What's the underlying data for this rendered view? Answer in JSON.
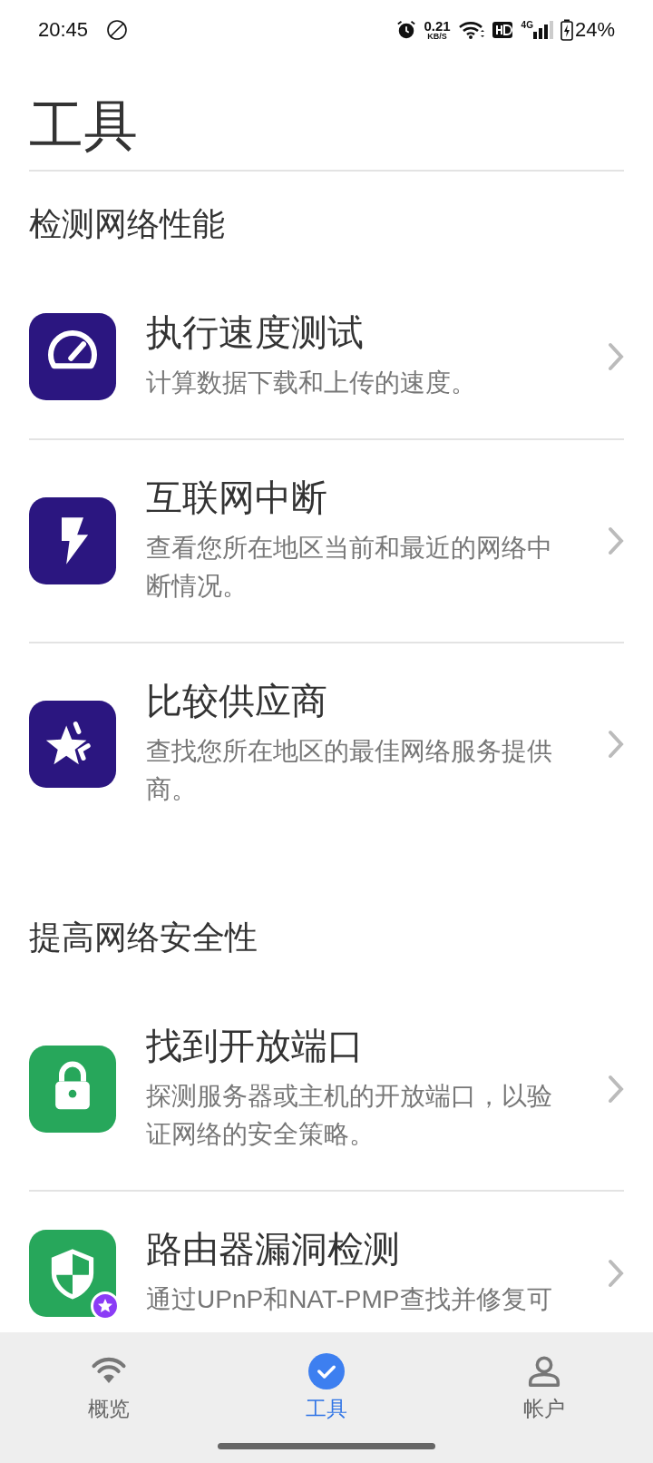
{
  "status_bar": {
    "time": "20:45",
    "speed_value": "0.21",
    "speed_unit": "KB/S",
    "network": "4G",
    "battery": "24%"
  },
  "page_title": "工具",
  "sections": [
    {
      "title": "检测网络性能",
      "items": [
        {
          "kind": "gauge",
          "color": "#2b1680",
          "title": "执行速度测试",
          "description": "计算数据下载和上传的速度。",
          "premium": false
        },
        {
          "kind": "bolt",
          "color": "#2b1680",
          "title": "互联网中断",
          "description": "查看您所在地区当前和最近的网络中断情况。",
          "premium": false
        },
        {
          "kind": "star",
          "color": "#2b1680",
          "title": "比较供应商",
          "description": "查找您所在地区的最佳网络服务提供商。",
          "premium": false
        }
      ]
    },
    {
      "title": "提高网络安全性",
      "items": [
        {
          "kind": "lock",
          "color": "#27a75b",
          "title": "找到开放端口",
          "description": "探测服务器或主机的开放端口，以验证网络的安全策略。",
          "premium": false
        },
        {
          "kind": "shield",
          "color": "#27a75b",
          "title": "路由器漏洞检测",
          "description": "通过UPnP和NAT-PMP查找并修复可",
          "premium": true
        }
      ]
    }
  ],
  "tabs": [
    {
      "kind": "wifi",
      "label": "概览",
      "selected": false
    },
    {
      "kind": "check",
      "label": "工具",
      "selected": true
    },
    {
      "kind": "person",
      "label": "帐户",
      "selected": false
    }
  ]
}
